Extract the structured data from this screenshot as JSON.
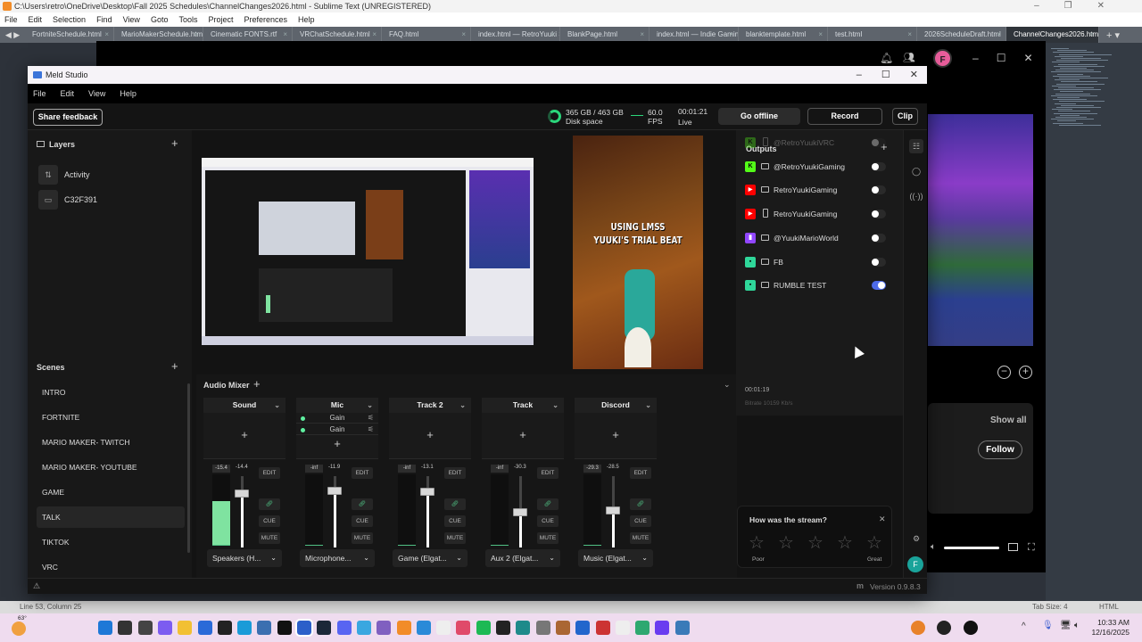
{
  "sublime": {
    "title": "C:\\Users\\retro\\OneDrive\\Desktop\\Fall 2025 Schedules\\ChannelChanges2026.html - Sublime Text (UNREGISTERED)",
    "menu": [
      "File",
      "Edit",
      "Selection",
      "Find",
      "View",
      "Goto",
      "Tools",
      "Project",
      "Preferences",
      "Help"
    ],
    "tabs": [
      "FortniteSchedule.html",
      "MarioMakerSchedule.html",
      "Cinematic FONTS.rtf",
      "VRChatSchedule.html",
      "FAQ.html",
      "index.html — RetroYuuki Site",
      "BlankPage.html",
      "index.html — Indie Gaming Site",
      "blanktemplate.html",
      "test.html",
      "2026ScheduleDraft.html",
      "ChannelChanges2026.html"
    ],
    "active_tab": 11,
    "status_position": "Line 53, Column 25",
    "status_tabsize": "Tab Size: 4",
    "status_syntax": "HTML"
  },
  "browser": {
    "avatar": "F",
    "show_all": "Show all",
    "follow": "Follow"
  },
  "meld": {
    "title": "Meld Studio",
    "menu": [
      "File",
      "Edit",
      "View",
      "Help"
    ],
    "share_feedback": "Share feedback",
    "disk": {
      "value": "365 GB / 463 GB",
      "label": "Disk space",
      "used_fraction": 0.79
    },
    "fps": {
      "value": "60.0",
      "label": "FPS"
    },
    "live": {
      "time": "00:01:21",
      "label": "Live"
    },
    "go_offline": "Go offline",
    "record": "Record",
    "clip": "Clip",
    "layers_title": "Layers",
    "layers": [
      {
        "name": "Activity",
        "icon": "activity-icon"
      },
      {
        "name": "C32F391",
        "icon": "monitor-icon"
      }
    ],
    "scenes_title": "Scenes",
    "scenes": [
      "INTRO",
      "FORTNITE",
      "MARIO MAKER- TWITCH",
      "MARIO MAKER- YOUTUBE",
      "GAME",
      "TALK",
      "TIKTOK",
      "VRC"
    ],
    "selected_scene": 5,
    "vertical_preview_text": [
      "USING LMSS",
      "YUUKI'S TRIAL BEAT"
    ],
    "mixer_title": "Audio Mixer",
    "channels": [
      {
        "name": "Sound",
        "fx": [],
        "meter_label": "-15.4",
        "meter_level": 0.62,
        "fader_db": "-14.4",
        "fader": -14.4,
        "device": "Speakers (H..."
      },
      {
        "name": "Mic",
        "fx": [
          "Gain",
          "Gain"
        ],
        "meter_label": "-inf",
        "meter_level": 0,
        "fader_db": "-11.9",
        "fader": -11.9,
        "device": "Microphone..."
      },
      {
        "name": "Track 2",
        "fx": [],
        "meter_label": "-inf",
        "meter_level": 0,
        "fader_db": "-13.1",
        "fader": -13.1,
        "device": "Game (Elgat..."
      },
      {
        "name": "Track",
        "fx": [],
        "meter_label": "-inf",
        "meter_level": 0,
        "fader_db": "-30.3",
        "fader": -30.3,
        "device": "Aux 2 (Elgat..."
      },
      {
        "name": "Discord",
        "fx": [],
        "meter_label": "-29.3",
        "meter_level": 0,
        "fader_db": "-28.5",
        "fader": -28.5,
        "device": "Music (Elgat..."
      }
    ],
    "strip_buttons": {
      "edit": "EDIT",
      "cue": "CUE",
      "mute": "MUTE"
    },
    "outputs_title": "Outputs",
    "outputs": [
      {
        "name": "@RetroYuukiVRC",
        "platform": "kick",
        "orientation": "portrait",
        "on": false,
        "faded": true
      },
      {
        "name": "@RetroYuukiGaming",
        "platform": "kick",
        "orientation": "landscape",
        "on": false
      },
      {
        "name": "RetroYuukiGaming",
        "platform": "youtube",
        "orientation": "landscape",
        "on": false
      },
      {
        "name": "RetroYuukiGaming",
        "platform": "youtube",
        "orientation": "portrait",
        "on": false
      },
      {
        "name": "@YuukiMarioWorld",
        "platform": "twitch",
        "orientation": "landscape",
        "on": false
      },
      {
        "name": "FB",
        "platform": "custom",
        "orientation": "landscape",
        "on": false
      },
      {
        "name": "RUMBLE TEST",
        "platform": "custom",
        "orientation": "landscape",
        "on": true
      }
    ],
    "output_elapsed": "00:01:19",
    "output_bitrate": "Bitrate  10159 Kb/s",
    "platform_colors": {
      "kick": "#53fc18",
      "youtube": "#ff0000",
      "twitch": "#9146ff",
      "custom": "#2fd79a"
    },
    "feedback": {
      "title": "How was the stream?",
      "poor": "Poor",
      "great": "Great",
      "stars": 5
    },
    "user_avatar": "F",
    "version": "Version 0.9.8.3"
  },
  "taskbar": {
    "weather": "63°",
    "icons": [
      "start-icon",
      "search-icon",
      "task-view-icon",
      "copilot-icon",
      "file-explorer-icon",
      "store-icon",
      "epic-games-icon",
      "edge-icon",
      "notepad-icon",
      "media-player-icon",
      "meld-icon",
      "steam-icon",
      "discord-icon",
      "dolphin-icon",
      "app-icon",
      "sublime-icon",
      "calendar-icon",
      "file-icon",
      "snipping-icon",
      "spotify-icon",
      "waveform-icon",
      "captions-icon",
      "settings-gear-icon",
      "game-icon",
      "bars-icon",
      "color-icon",
      "terminal-icon",
      "green-app-icon",
      "grid-app-icon",
      "settings-icon",
      "fl-studio-icon",
      "obs-icon",
      "arrow-app-icon"
    ],
    "icon_colors": [
      "#1e78d7",
      "#333",
      "#444",
      "#7c5cf0",
      "#f2c033",
      "#2a6ad8",
      "#222",
      "#1a9bd8",
      "#3b6fb0",
      "#111",
      "#2c5fc9",
      "#1b2838",
      "#5865f2",
      "#3aa7e0",
      "#8060c0",
      "#f28c28",
      "#2a8ad8",
      "#eee",
      "#e04a6a",
      "#1db954",
      "#222",
      "#1e8a8a",
      "#777",
      "#aa6633",
      "#2266cc",
      "#cc3333",
      "#eee",
      "#2ea870",
      "#6a3cf0",
      "#3a7ab8",
      "#e8822a",
      "#222",
      "#111"
    ],
    "time": "10:33 AM",
    "date": "12/16/2025"
  }
}
